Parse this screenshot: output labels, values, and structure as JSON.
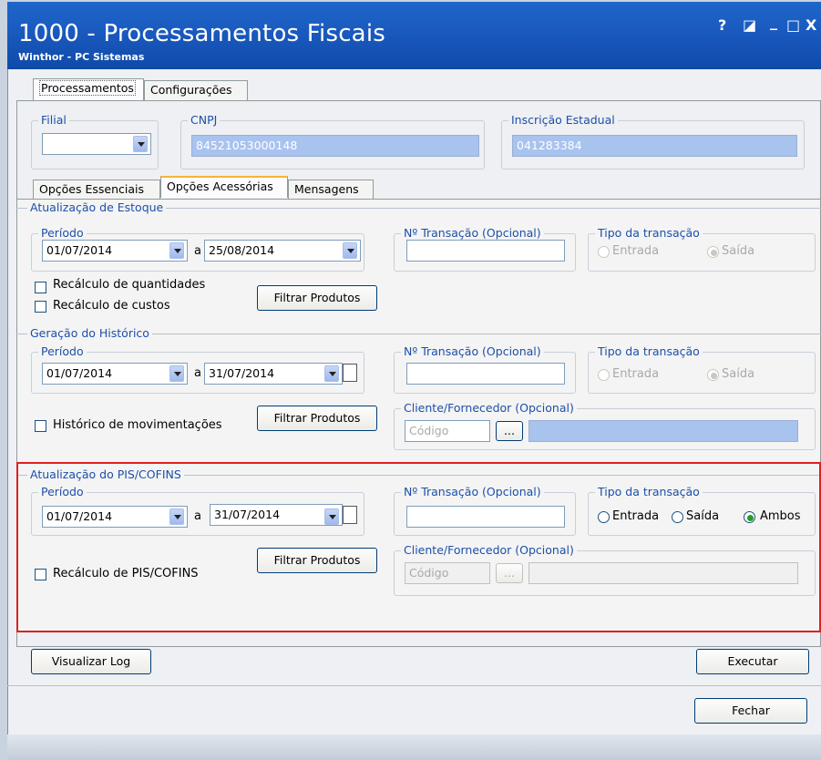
{
  "window": {
    "title": "1000 - Processamentos Fiscais",
    "subtitle": "Winthor - PC Sistemas",
    "buttons": {
      "help": "?",
      "restore": "◪",
      "minimize": "_",
      "maximize": "□",
      "close": "X"
    }
  },
  "top_tabs": [
    "Processamentos",
    "Configurações"
  ],
  "header": {
    "filial": {
      "label": "Filial",
      "value": ""
    },
    "cnpj": {
      "label": "CNPJ",
      "value": "84521053000148"
    },
    "ie": {
      "label": "Inscrição Estadual",
      "value": "041283384"
    }
  },
  "sub_tabs": [
    "Opções Essenciais",
    "Opções Acessórias",
    "Mensagens"
  ],
  "estoque": {
    "title": "Atualização de Estoque",
    "periodo_label": "Período",
    "date_from": "01/07/2014",
    "sep": "a",
    "date_to": "25/08/2014",
    "ntrans_label": "Nº Transação (Opcional)",
    "ntrans_value": "",
    "tipo_label": "Tipo da transação",
    "entrada": "Entrada",
    "saida": "Saída",
    "chk_qtd": "Recálculo de quantidades",
    "chk_custos": "Recálculo de custos",
    "filtrar": "Filtrar Produtos"
  },
  "historico": {
    "title": "Geração do Histórico",
    "periodo_label": "Período",
    "date_from": "01/07/2014",
    "sep": "a",
    "date_to": "31/07/2014",
    "ntrans_label": "Nº Transação (Opcional)",
    "ntrans_value": "",
    "tipo_label": "Tipo da transação",
    "entrada": "Entrada",
    "saida": "Saída",
    "cliente_label": "Cliente/Fornecedor (Opcional)",
    "codigo_placeholder": "Código",
    "ellipsis": "...",
    "chk_hist": "Histórico de movimentações",
    "filtrar": "Filtrar Produtos"
  },
  "piscofins": {
    "title": "Atualização do PIS/COFINS",
    "periodo_label": "Período",
    "date_from": "01/07/2014",
    "sep": "a",
    "date_to": "31/07/2014",
    "ntrans_label": "Nº Transação (Opcional)",
    "ntrans_value": "",
    "tipo_label": "Tipo da transação",
    "entrada": "Entrada",
    "saida": "Saída",
    "ambos": "Ambos",
    "selected": "Ambos",
    "cliente_label": "Cliente/Fornecedor (Opcional)",
    "codigo_placeholder": "Código",
    "ellipsis": "...",
    "chk_recalc": "Recálculo de PIS/COFINS",
    "filtrar": "Filtrar Produtos"
  },
  "footer": {
    "visualizar_log": "Visualizar Log",
    "executar": "Executar",
    "fechar": "Fechar"
  },
  "colors": {
    "title_bar": "#1b5bc0",
    "readonly_field": "#a9c3ef",
    "group_label": "#1d4fa8",
    "highlight": "#e02020"
  }
}
